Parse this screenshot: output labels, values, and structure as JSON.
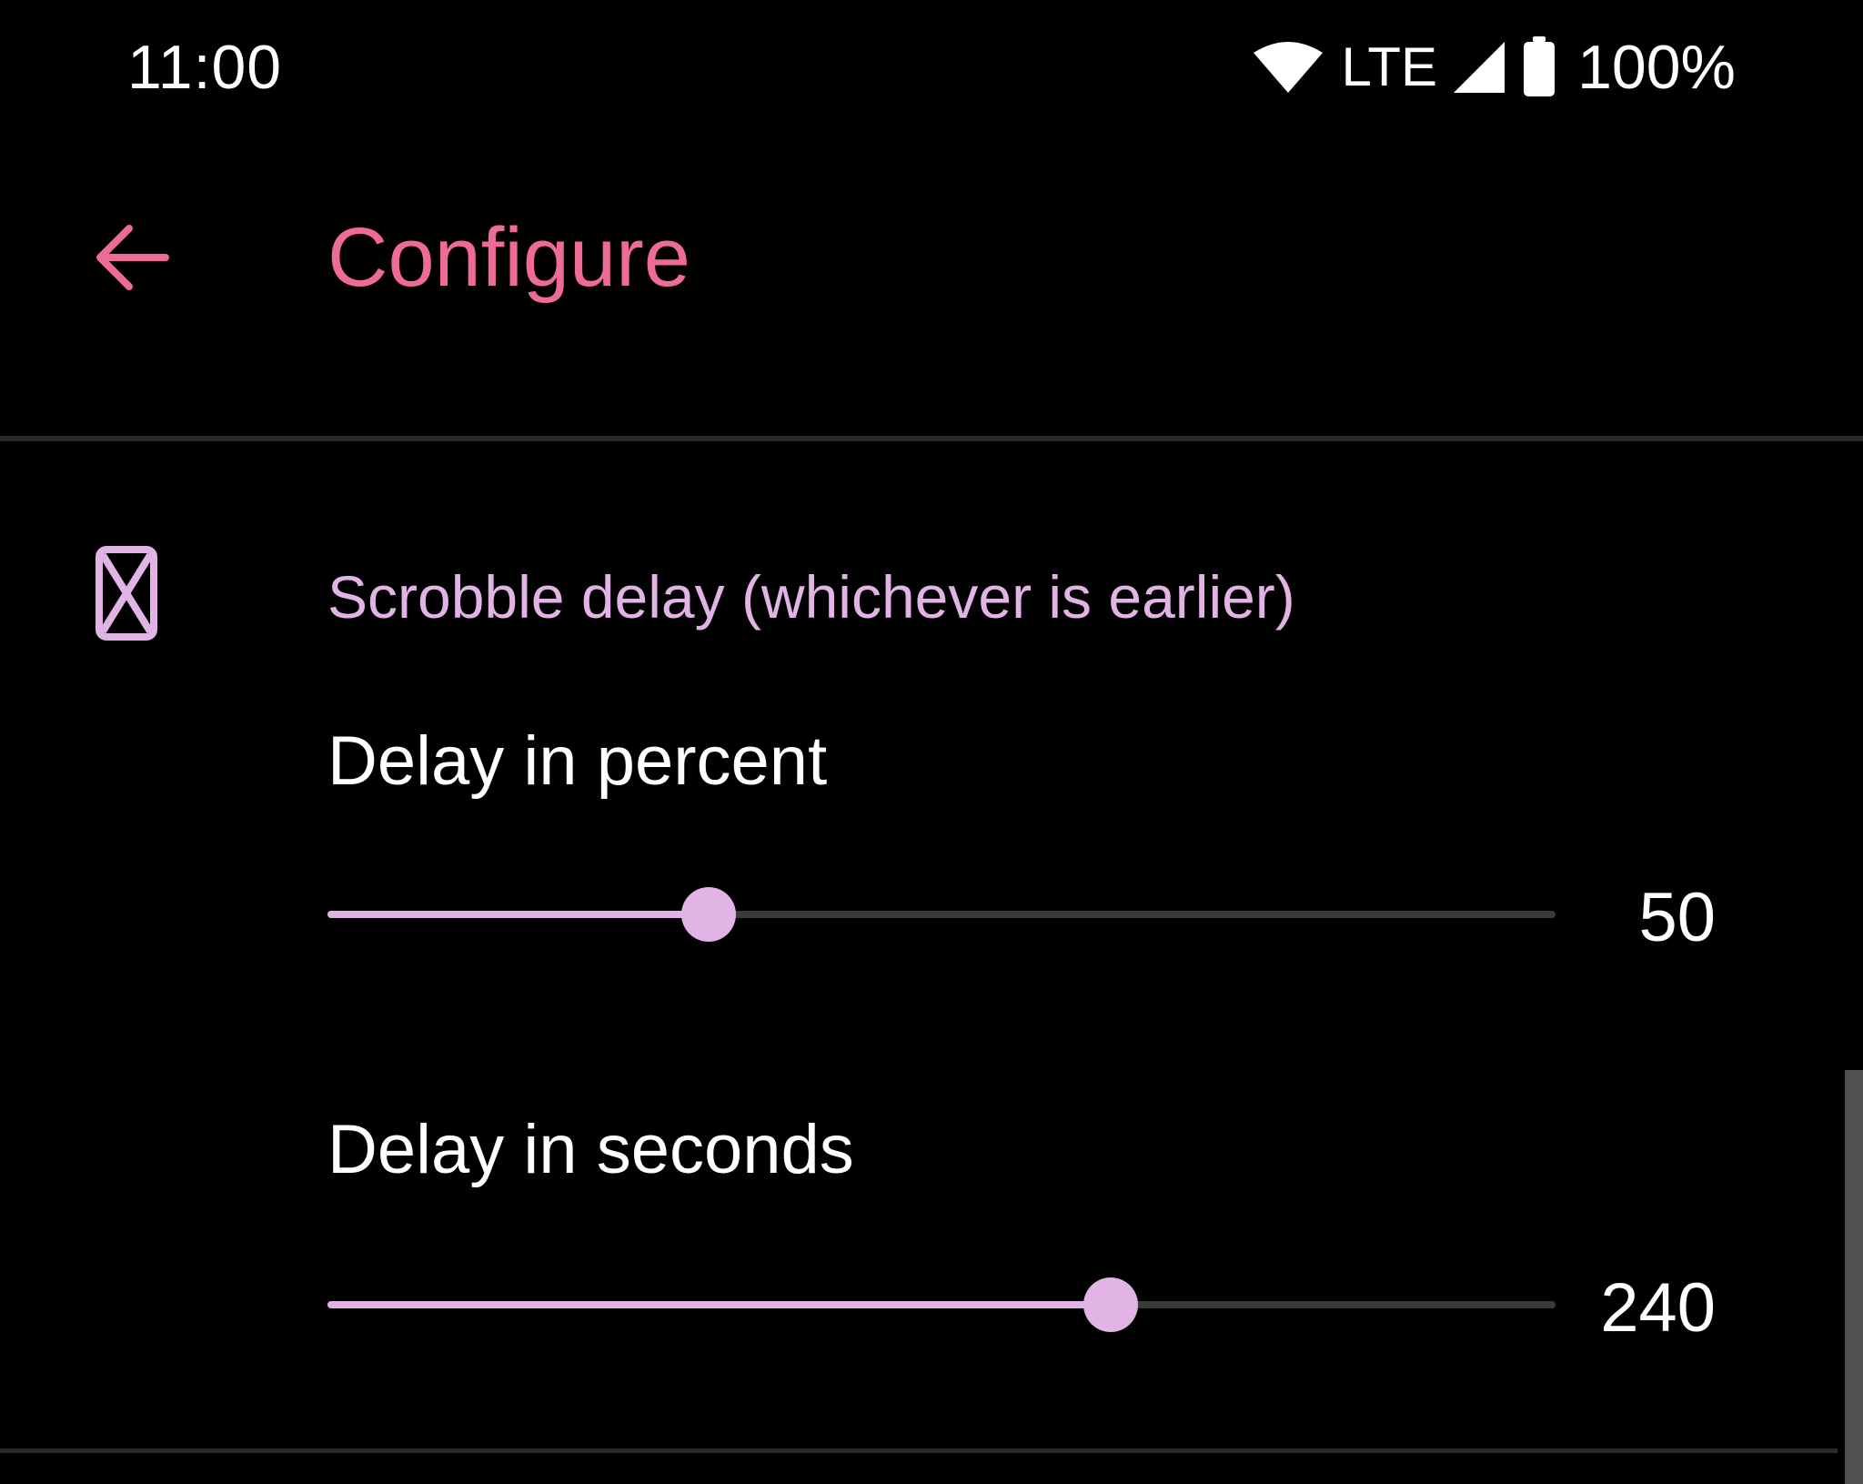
{
  "status_bar": {
    "time": "11:00",
    "network": "LTE",
    "battery": "100%",
    "icons": [
      "wifi-icon",
      "cell-signal-icon",
      "battery-icon"
    ]
  },
  "app_bar": {
    "back_icon": "arrow-back-icon",
    "title": "Configure"
  },
  "section": {
    "icon": "hourglass-icon",
    "title": "Scrobble delay (whichever is earlier)",
    "items": [
      {
        "label": "Delay in percent",
        "value": "50",
        "fraction": 0.31
      },
      {
        "label": "Delay in seconds",
        "value": "240",
        "fraction": 0.638
      }
    ]
  },
  "colors": {
    "background": "#000000",
    "accent": "#ee6a97",
    "slider_active": "#e2b4e6",
    "slider_inactive": "#3a3a3a",
    "divider": "#2a2a2a"
  }
}
